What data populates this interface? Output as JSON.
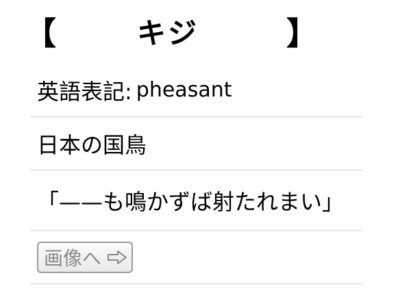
{
  "title": {
    "open_bracket": "【",
    "word": "キジ",
    "close_bracket": "】"
  },
  "details": {
    "english_label": "英語表記:",
    "english_value": "pheasant",
    "fact": "日本の国鳥",
    "proverb": "「——も鳴かずば射たれまい」"
  },
  "image_button": {
    "label": "画像へ",
    "icon": "right-arrow-icon"
  },
  "colors": {
    "divider": "#ededed",
    "button_border": "#9a9a9a",
    "button_text": "#8a8a8a"
  }
}
